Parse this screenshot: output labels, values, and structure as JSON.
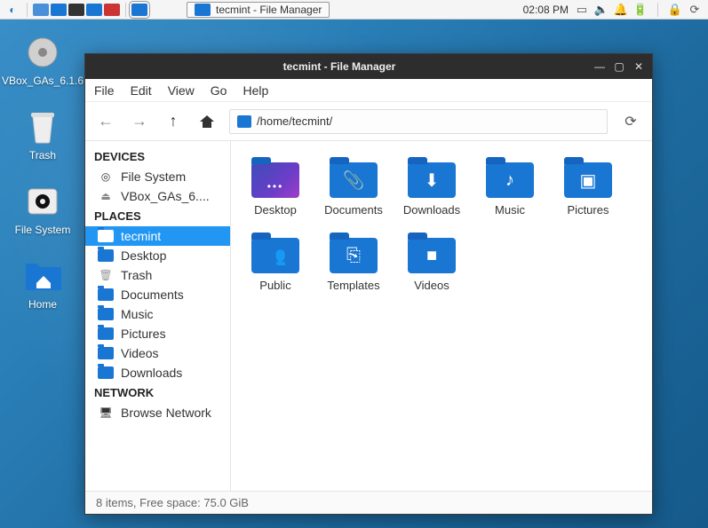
{
  "panel": {
    "taskbar_app_label": "tecmint - File Manager",
    "clock": "02:08 PM"
  },
  "desktop_icons": [
    {
      "label": "VBox_GAs_6.1.6",
      "glyph": "disc"
    },
    {
      "label": "Trash",
      "glyph": "trash"
    },
    {
      "label": "File System",
      "glyph": "disk"
    },
    {
      "label": "Home",
      "glyph": "home"
    }
  ],
  "window": {
    "title": "tecmint - File Manager",
    "menubar": [
      "File",
      "Edit",
      "View",
      "Go",
      "Help"
    ],
    "path": "/home/tecmint/",
    "status": "8 items, Free space: 75.0 GiB"
  },
  "sidebar": {
    "devices_heading": "DEVICES",
    "devices": [
      {
        "label": "File System",
        "icon": "fs"
      },
      {
        "label": "VBox_GAs_6....",
        "icon": "eject"
      }
    ],
    "places_heading": "PLACES",
    "places": [
      {
        "label": "tecmint",
        "icon": "folder",
        "selected": true
      },
      {
        "label": "Desktop",
        "icon": "folder"
      },
      {
        "label": "Trash",
        "icon": "trash"
      },
      {
        "label": "Documents",
        "icon": "folder"
      },
      {
        "label": "Music",
        "icon": "folder"
      },
      {
        "label": "Pictures",
        "icon": "folder"
      },
      {
        "label": "Videos",
        "icon": "folder"
      },
      {
        "label": "Downloads",
        "icon": "folder"
      }
    ],
    "network_heading": "NETWORK",
    "network": [
      {
        "label": "Browse Network",
        "icon": "network"
      }
    ]
  },
  "folders": [
    {
      "name": "Desktop",
      "icon": "dots",
      "variant": "desktop"
    },
    {
      "name": "Documents",
      "icon": "clip"
    },
    {
      "name": "Downloads",
      "icon": "download"
    },
    {
      "name": "Music",
      "icon": "music"
    },
    {
      "name": "Pictures",
      "icon": "picture"
    },
    {
      "name": "Public",
      "icon": "public"
    },
    {
      "name": "Templates",
      "icon": "template"
    },
    {
      "name": "Videos",
      "icon": "video"
    }
  ]
}
